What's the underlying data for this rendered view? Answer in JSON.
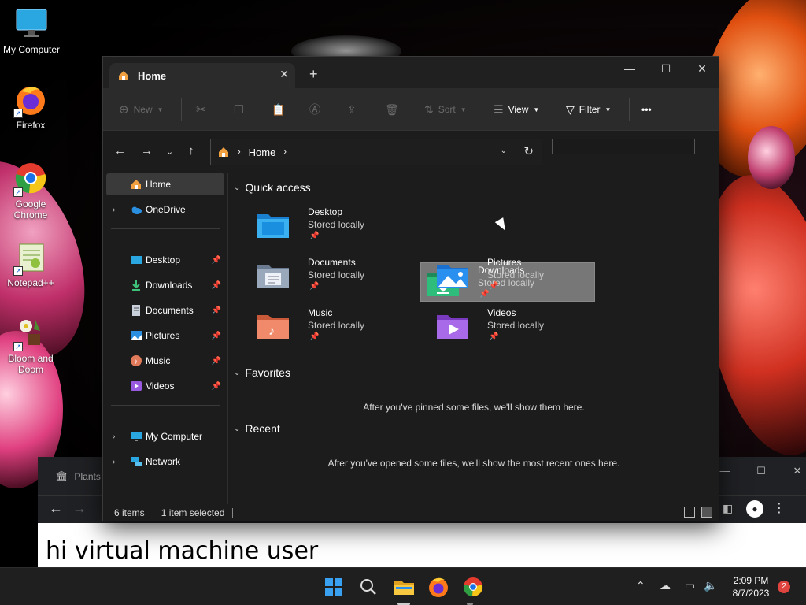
{
  "desktop": {
    "icons": [
      {
        "label": "My Computer",
        "icon": "monitor-icon"
      },
      {
        "label": "Firefox",
        "icon": "firefox-icon"
      },
      {
        "label": "Google Chrome",
        "icon": "chrome-icon"
      },
      {
        "label": "Notepad++",
        "icon": "notepadpp-icon"
      },
      {
        "label": "Bloom and Doom",
        "icon": "bloom-doom-icon"
      }
    ]
  },
  "background_browser": {
    "tab_title": "Plants",
    "page_text": "hi virtual machine user"
  },
  "explorer": {
    "tab_title": "Home",
    "toolbar": {
      "new_label": "New",
      "sort_label": "Sort",
      "view_label": "View",
      "filter_label": "Filter",
      "more_label": "•••"
    },
    "address": {
      "path": "Home"
    },
    "sidebar": {
      "items": [
        {
          "label": "Home"
        },
        {
          "label": "OneDrive"
        },
        {
          "label": "Desktop"
        },
        {
          "label": "Downloads"
        },
        {
          "label": "Documents"
        },
        {
          "label": "Pictures"
        },
        {
          "label": "Music"
        },
        {
          "label": "Videos"
        },
        {
          "label": "My Computer"
        },
        {
          "label": "Network"
        }
      ]
    },
    "quick_access": {
      "heading": "Quick access",
      "folders": [
        {
          "name": "Desktop",
          "status": "Stored locally"
        },
        {
          "name": "Downloads",
          "status": "Stored locally"
        },
        {
          "name": "Documents",
          "status": "Stored locally"
        },
        {
          "name": "Pictures",
          "status": "Stored locally"
        },
        {
          "name": "Music",
          "status": "Stored locally"
        },
        {
          "name": "Videos",
          "status": "Stored locally"
        }
      ]
    },
    "favorites": {
      "heading": "Favorites",
      "empty_text": "After you've pinned some files, we'll show them here."
    },
    "recent": {
      "heading": "Recent",
      "empty_text": "After you've opened some files, we'll show the most recent ones here."
    },
    "status": {
      "items_count": "6 items",
      "selected": "1 item selected"
    }
  },
  "taskbar": {
    "time": "2:09 PM",
    "date": "8/7/2023",
    "notification_count": "2"
  },
  "colors": {
    "accent": "#0078d4",
    "selection": "#777777",
    "taskbar": "#1f1f1f"
  }
}
